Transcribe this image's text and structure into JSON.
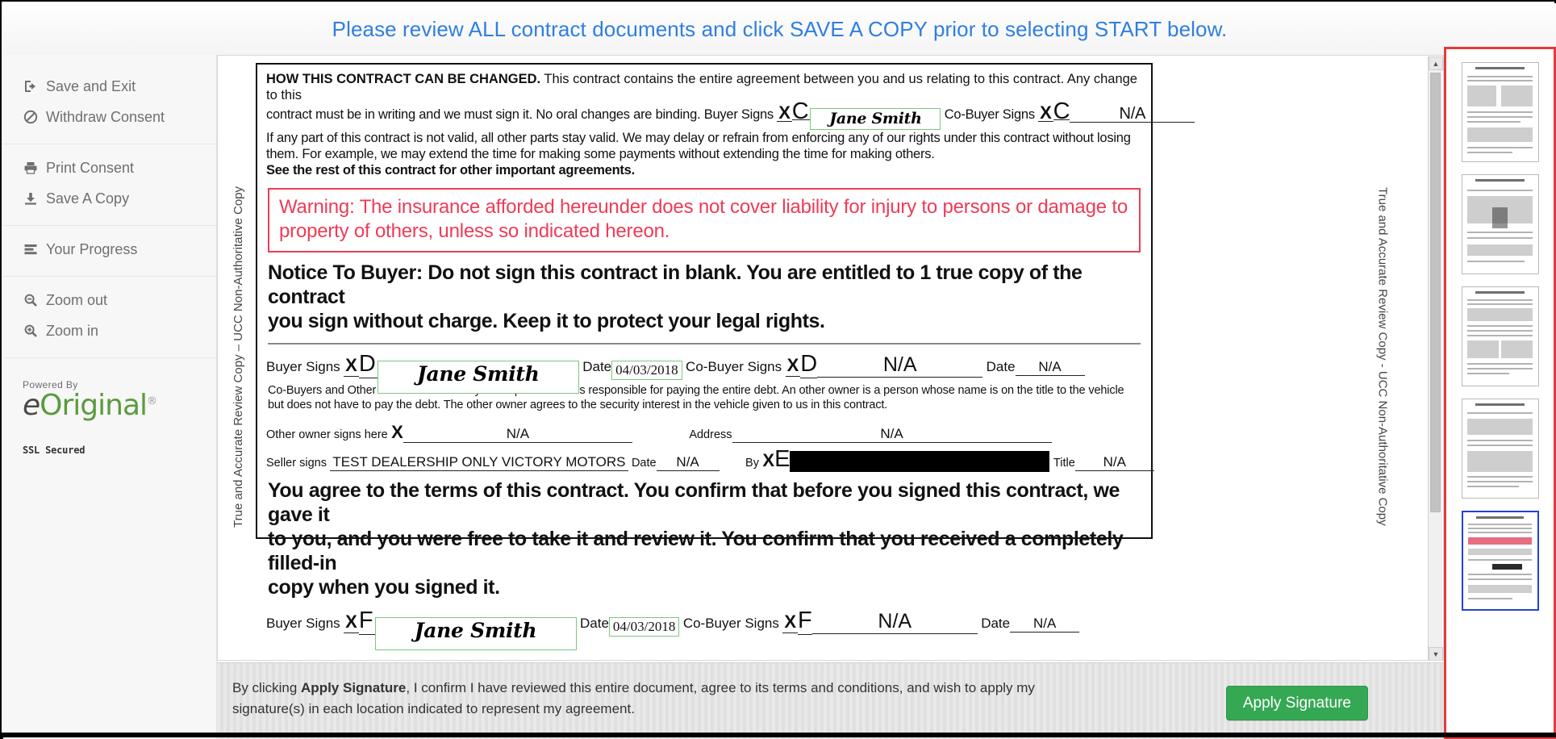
{
  "banner": {
    "message": "Please review ALL contract documents and click SAVE A COPY prior to selecting START below.",
    "color": "#2f7fe0"
  },
  "sidebar": {
    "groups": [
      {
        "items": [
          {
            "label": "Save and Exit",
            "icon": "sign-out-icon"
          },
          {
            "label": "Withdraw Consent",
            "icon": "ban-icon"
          }
        ]
      },
      {
        "items": [
          {
            "label": "Print Consent",
            "icon": "printer-icon"
          },
          {
            "label": "Save A Copy",
            "icon": "download-icon"
          }
        ]
      },
      {
        "items": [
          {
            "label": "Your Progress",
            "icon": "list-icon"
          }
        ]
      },
      {
        "items": [
          {
            "label": "Zoom out",
            "icon": "zoom-out-icon"
          },
          {
            "label": "Zoom in",
            "icon": "zoom-in-icon"
          }
        ]
      }
    ],
    "brand": {
      "powered_by": "Powered By",
      "logo_e": "e",
      "logo_rest": "Original",
      "registered_mark": "®",
      "ssl": "SSL Secured",
      "logo_color": "#5b9b3f"
    }
  },
  "viewer": {
    "rail_left": "True and Accurate Review Copy – UCC Non-Authoritative Copy",
    "rail_right": "True and Accurate Review Copy - UCC Non-Authoritative Copy",
    "scroll_up_arrow": "▲",
    "scroll_down_arrow": "▼"
  },
  "document": {
    "section_heading": "HOW THIS CONTRACT CAN BE CHANGED.",
    "para1_a": "This contract contains the entire agreement between you and us relating to this contract. Any change to this",
    "para1_b": "contract must be in writing and we must sign it. No oral changes are binding.",
    "buyer_signs_label": "Buyer Signs",
    "cobuyer_signs_label": "Co-Buyer Signs",
    "x_mark": "X",
    "tag_c": "C",
    "tag_d": "D",
    "tag_e": "E",
    "tag_f": "F",
    "signature_name": "Jane Smith",
    "na": "N/A",
    "para2": "If any part of this contract is not valid, all other parts stay valid. We may delay or refrain from enforcing any of our rights under this contract without losing",
    "para3": "them. For example, we may extend the time for making some payments without extending the time for making others.",
    "para4_bold": "See the rest of this contract for other important agreements.",
    "warning": "Warning: The insurance afforded hereunder does not cover liability for injury to persons or damage to property of others, unless so indicated hereon.",
    "warning_color": "#ef3b57",
    "notice_line1": "Notice To Buyer: Do not sign this contract in blank. You are entitled to 1 true copy of the contract",
    "notice_line2": "you sign without charge. Keep it to protect your legal rights.",
    "date_label": "Date",
    "date_value": "04/03/2018",
    "cobuyers_note": "Co-Buyers and Other Owners — A co-buyer is a person who is responsible for paying the entire debt. An other owner is a person whose name is on the title to the vehicle but does not have to pay the debt. The other owner agrees to the security interest in the vehicle given to us in this contract.",
    "other_owner_label": "Other owner signs here",
    "address_label": "Address",
    "seller_signs_label": "Seller signs",
    "seller_name": "TEST DEALERSHIP ONLY VICTORY MOTORS",
    "by_label": "By",
    "title_label": "Title",
    "agree_line1": "You agree to the terms of this contract. You confirm that before you signed this contract, we gave it",
    "agree_line2": "to you, and you were free to take it and review it. You confirm that you received a completely filled-in",
    "agree_line3": "copy when you signed it."
  },
  "footer": {
    "text_prefix": "By clicking ",
    "text_bold": "Apply Signature",
    "text_suffix": ", I confirm I have reviewed this entire document, agree to its terms and conditions, and wish to apply my signature(s) in each location indicated to represent my agreement.",
    "apply_button": "Apply Signature",
    "apply_button_color": "#35a853"
  },
  "thumbnails": {
    "highlight_color": "#e23b3b",
    "selected_color": "#2440d8",
    "pages": [
      {
        "index": "1",
        "selected": false
      },
      {
        "index": "2",
        "selected": false
      },
      {
        "index": "3",
        "selected": false
      },
      {
        "index": "4",
        "selected": false
      },
      {
        "index": "5",
        "selected": true
      }
    ]
  }
}
